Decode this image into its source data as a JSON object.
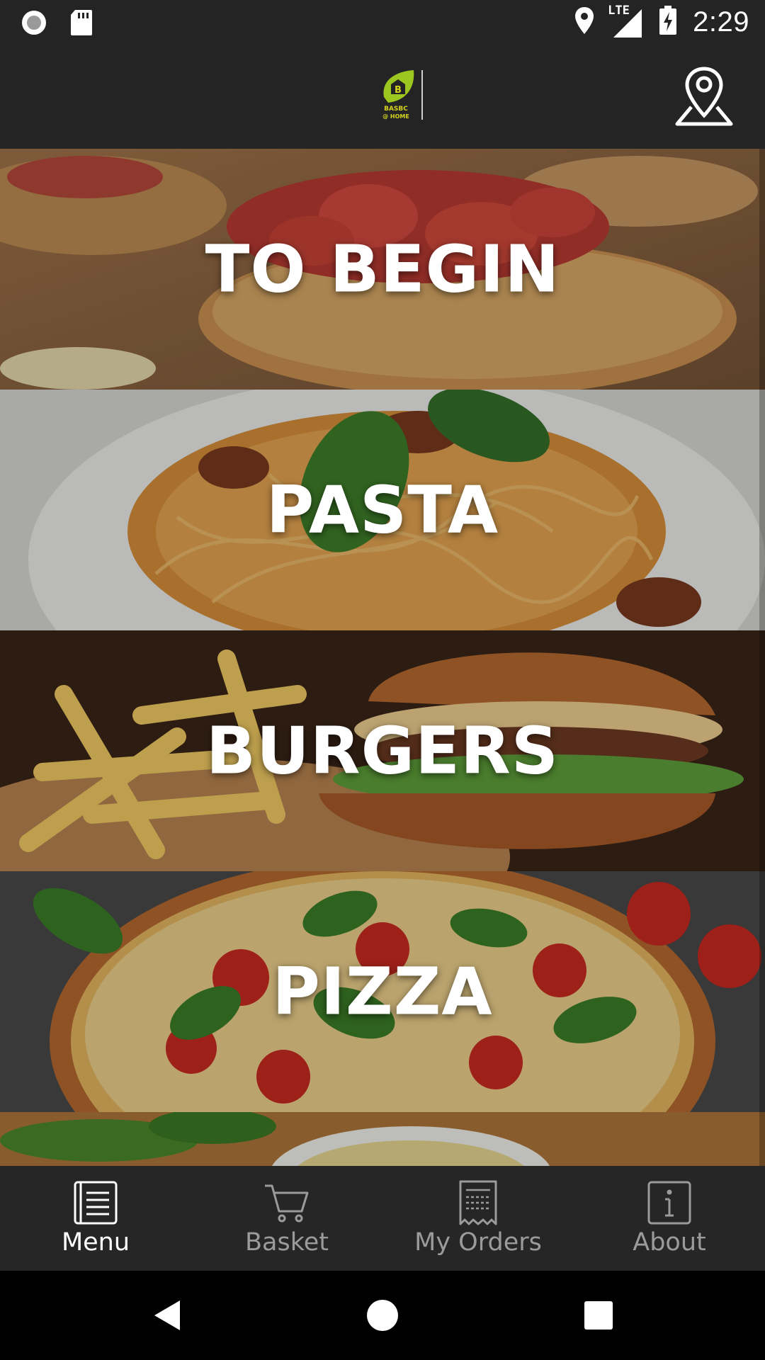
{
  "status_bar": {
    "time": "2:29",
    "network": "LTE",
    "icons": [
      "record-icon",
      "sd-card-icon",
      "location-pin-icon",
      "lte-signal-icon",
      "battery-charging-icon"
    ]
  },
  "header": {
    "logo_icon": "basbc-at-home-logo",
    "location_icon": "map-location-icon"
  },
  "categories": [
    {
      "label": "TO BEGIN"
    },
    {
      "label": "PASTA"
    },
    {
      "label": "BURGERS"
    },
    {
      "label": "PIZZA"
    },
    {
      "label": ""
    }
  ],
  "bottom_nav": {
    "items": [
      {
        "label": "Menu",
        "icon": "menu-list-icon",
        "active": true
      },
      {
        "label": "Basket",
        "icon": "basket-cart-icon",
        "active": false
      },
      {
        "label": "My Orders",
        "icon": "receipt-icon",
        "active": false
      },
      {
        "label": "About",
        "icon": "info-icon",
        "active": false
      }
    ]
  },
  "colors": {
    "bar_background": "#242424",
    "logo_green": "#9cc620",
    "logo_yellow": "#d6d31c",
    "nav_inactive": "#9b9b9b",
    "nav_active": "#ffffff"
  }
}
